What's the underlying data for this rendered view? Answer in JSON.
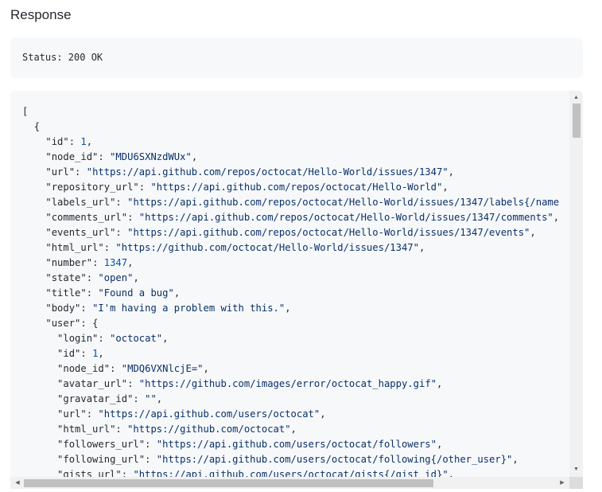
{
  "section": {
    "heading": "Response"
  },
  "status": {
    "text": "Status: 200 OK"
  },
  "json_lines": [
    {
      "indent": 0,
      "parts": [
        {
          "t": "p",
          "v": "["
        }
      ]
    },
    {
      "indent": 1,
      "parts": [
        {
          "t": "p",
          "v": "{"
        }
      ]
    },
    {
      "indent": 2,
      "parts": [
        {
          "t": "k",
          "v": "\"id\""
        },
        {
          "t": "p",
          "v": ": "
        },
        {
          "t": "n",
          "v": "1"
        },
        {
          "t": "p",
          "v": ","
        }
      ]
    },
    {
      "indent": 2,
      "parts": [
        {
          "t": "k",
          "v": "\"node_id\""
        },
        {
          "t": "p",
          "v": ": "
        },
        {
          "t": "s",
          "v": "\"MDU6SXNzdWUx\""
        },
        {
          "t": "p",
          "v": ","
        }
      ]
    },
    {
      "indent": 2,
      "parts": [
        {
          "t": "k",
          "v": "\"url\""
        },
        {
          "t": "p",
          "v": ": "
        },
        {
          "t": "s",
          "v": "\"https://api.github.com/repos/octocat/Hello-World/issues/1347\""
        },
        {
          "t": "p",
          "v": ","
        }
      ]
    },
    {
      "indent": 2,
      "parts": [
        {
          "t": "k",
          "v": "\"repository_url\""
        },
        {
          "t": "p",
          "v": ": "
        },
        {
          "t": "s",
          "v": "\"https://api.github.com/repos/octocat/Hello-World\""
        },
        {
          "t": "p",
          "v": ","
        }
      ]
    },
    {
      "indent": 2,
      "parts": [
        {
          "t": "k",
          "v": "\"labels_url\""
        },
        {
          "t": "p",
          "v": ": "
        },
        {
          "t": "s",
          "v": "\"https://api.github.com/repos/octocat/Hello-World/issues/1347/labels{/name"
        }
      ]
    },
    {
      "indent": 2,
      "parts": [
        {
          "t": "k",
          "v": "\"comments_url\""
        },
        {
          "t": "p",
          "v": ": "
        },
        {
          "t": "s",
          "v": "\"https://api.github.com/repos/octocat/Hello-World/issues/1347/comments\""
        },
        {
          "t": "p",
          "v": ","
        }
      ]
    },
    {
      "indent": 2,
      "parts": [
        {
          "t": "k",
          "v": "\"events_url\""
        },
        {
          "t": "p",
          "v": ": "
        },
        {
          "t": "s",
          "v": "\"https://api.github.com/repos/octocat/Hello-World/issues/1347/events\""
        },
        {
          "t": "p",
          "v": ","
        }
      ]
    },
    {
      "indent": 2,
      "parts": [
        {
          "t": "k",
          "v": "\"html_url\""
        },
        {
          "t": "p",
          "v": ": "
        },
        {
          "t": "s",
          "v": "\"https://github.com/octocat/Hello-World/issues/1347\""
        },
        {
          "t": "p",
          "v": ","
        }
      ]
    },
    {
      "indent": 2,
      "parts": [
        {
          "t": "k",
          "v": "\"number\""
        },
        {
          "t": "p",
          "v": ": "
        },
        {
          "t": "n",
          "v": "1347"
        },
        {
          "t": "p",
          "v": ","
        }
      ]
    },
    {
      "indent": 2,
      "parts": [
        {
          "t": "k",
          "v": "\"state\""
        },
        {
          "t": "p",
          "v": ": "
        },
        {
          "t": "s",
          "v": "\"open\""
        },
        {
          "t": "p",
          "v": ","
        }
      ]
    },
    {
      "indent": 2,
      "parts": [
        {
          "t": "k",
          "v": "\"title\""
        },
        {
          "t": "p",
          "v": ": "
        },
        {
          "t": "s",
          "v": "\"Found a bug\""
        },
        {
          "t": "p",
          "v": ","
        }
      ]
    },
    {
      "indent": 2,
      "parts": [
        {
          "t": "k",
          "v": "\"body\""
        },
        {
          "t": "p",
          "v": ": "
        },
        {
          "t": "s",
          "v": "\"I'm having a problem with this.\""
        },
        {
          "t": "p",
          "v": ","
        }
      ]
    },
    {
      "indent": 2,
      "parts": [
        {
          "t": "k",
          "v": "\"user\""
        },
        {
          "t": "p",
          "v": ": {"
        }
      ]
    },
    {
      "indent": 3,
      "parts": [
        {
          "t": "k",
          "v": "\"login\""
        },
        {
          "t": "p",
          "v": ": "
        },
        {
          "t": "s",
          "v": "\"octocat\""
        },
        {
          "t": "p",
          "v": ","
        }
      ]
    },
    {
      "indent": 3,
      "parts": [
        {
          "t": "k",
          "v": "\"id\""
        },
        {
          "t": "p",
          "v": ": "
        },
        {
          "t": "n",
          "v": "1"
        },
        {
          "t": "p",
          "v": ","
        }
      ]
    },
    {
      "indent": 3,
      "parts": [
        {
          "t": "k",
          "v": "\"node_id\""
        },
        {
          "t": "p",
          "v": ": "
        },
        {
          "t": "s",
          "v": "\"MDQ6VXNlcjE=\""
        },
        {
          "t": "p",
          "v": ","
        }
      ]
    },
    {
      "indent": 3,
      "parts": [
        {
          "t": "k",
          "v": "\"avatar_url\""
        },
        {
          "t": "p",
          "v": ": "
        },
        {
          "t": "s",
          "v": "\"https://github.com/images/error/octocat_happy.gif\""
        },
        {
          "t": "p",
          "v": ","
        }
      ]
    },
    {
      "indent": 3,
      "parts": [
        {
          "t": "k",
          "v": "\"gravatar_id\""
        },
        {
          "t": "p",
          "v": ": "
        },
        {
          "t": "s",
          "v": "\"\""
        },
        {
          "t": "p",
          "v": ","
        }
      ]
    },
    {
      "indent": 3,
      "parts": [
        {
          "t": "k",
          "v": "\"url\""
        },
        {
          "t": "p",
          "v": ": "
        },
        {
          "t": "s",
          "v": "\"https://api.github.com/users/octocat\""
        },
        {
          "t": "p",
          "v": ","
        }
      ]
    },
    {
      "indent": 3,
      "parts": [
        {
          "t": "k",
          "v": "\"html_url\""
        },
        {
          "t": "p",
          "v": ": "
        },
        {
          "t": "s",
          "v": "\"https://github.com/octocat\""
        },
        {
          "t": "p",
          "v": ","
        }
      ]
    },
    {
      "indent": 3,
      "parts": [
        {
          "t": "k",
          "v": "\"followers_url\""
        },
        {
          "t": "p",
          "v": ": "
        },
        {
          "t": "s",
          "v": "\"https://api.github.com/users/octocat/followers\""
        },
        {
          "t": "p",
          "v": ","
        }
      ]
    },
    {
      "indent": 3,
      "parts": [
        {
          "t": "k",
          "v": "\"following_url\""
        },
        {
          "t": "p",
          "v": ": "
        },
        {
          "t": "s",
          "v": "\"https://api.github.com/users/octocat/following{/other_user}\""
        },
        {
          "t": "p",
          "v": ","
        }
      ]
    },
    {
      "indent": 3,
      "parts": [
        {
          "t": "k",
          "v": "\"gists_url\""
        },
        {
          "t": "p",
          "v": ": "
        },
        {
          "t": "s",
          "v": "\"https://api.github.com/users/octocat/gists{/gist_id}\""
        },
        {
          "t": "p",
          "v": ","
        }
      ]
    }
  ],
  "scrollbars": {
    "up_icon": "triangle-up-icon",
    "down_icon": "triangle-down-icon",
    "left_icon": "triangle-left-icon",
    "right_icon": "triangle-right-icon"
  },
  "colors": {
    "panel_bg": "#f6f8fa",
    "key": "#24292f",
    "string": "#0a3069",
    "number": "#0550ae"
  }
}
